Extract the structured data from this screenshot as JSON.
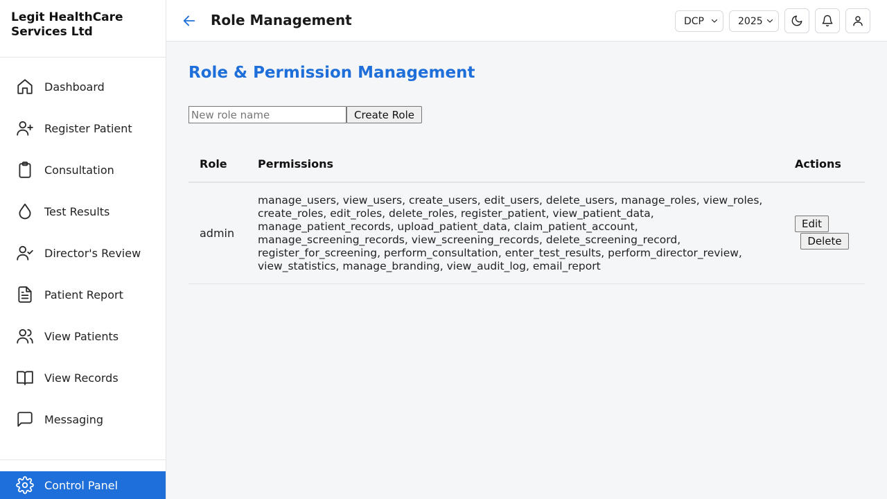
{
  "brand": {
    "name": "Legit HealthCare Services Ltd"
  },
  "sidebar": {
    "items": [
      {
        "label": "Dashboard",
        "icon": "home-icon"
      },
      {
        "label": "Register Patient",
        "icon": "user-plus-icon"
      },
      {
        "label": "Consultation",
        "icon": "clipboard-icon"
      },
      {
        "label": "Test Results",
        "icon": "droplet-icon"
      },
      {
        "label": "Director's Review",
        "icon": "user-check-icon"
      },
      {
        "label": "Patient Report",
        "icon": "file-text-icon"
      },
      {
        "label": "View Patients",
        "icon": "users-icon"
      },
      {
        "label": "View Records",
        "icon": "book-open-icon"
      },
      {
        "label": "Messaging",
        "icon": "message-square-icon"
      }
    ],
    "control_panel": {
      "label": "Control Panel",
      "icon": "gear-icon",
      "active": true
    }
  },
  "header": {
    "title": "Role Management",
    "org_select": {
      "value": "DCP"
    },
    "year_select": {
      "value": "2025"
    }
  },
  "main": {
    "section_title": "Role & Permission Management",
    "new_role": {
      "placeholder": "New role name",
      "value": ""
    },
    "create_label": "Create Role",
    "table": {
      "headers": {
        "role": "Role",
        "permissions": "Permissions",
        "actions": "Actions"
      },
      "rows": [
        {
          "role": "admin",
          "permissions": "manage_users, view_users, create_users, edit_users, delete_users, manage_roles, view_roles, create_roles, edit_roles, delete_roles, register_patient, view_patient_data, manage_patient_records, upload_patient_data, claim_patient_account, manage_screening_records, view_screening_records, delete_screening_record, register_for_screening, perform_consultation, enter_test_results, perform_director_review, view_statistics, manage_branding, view_audit_log, email_report",
          "edit_label": "Edit",
          "delete_label": "Delete"
        }
      ]
    }
  },
  "colors": {
    "accent": "#1e6fd9",
    "background": "#f5f6f8",
    "surface": "#ffffff"
  }
}
